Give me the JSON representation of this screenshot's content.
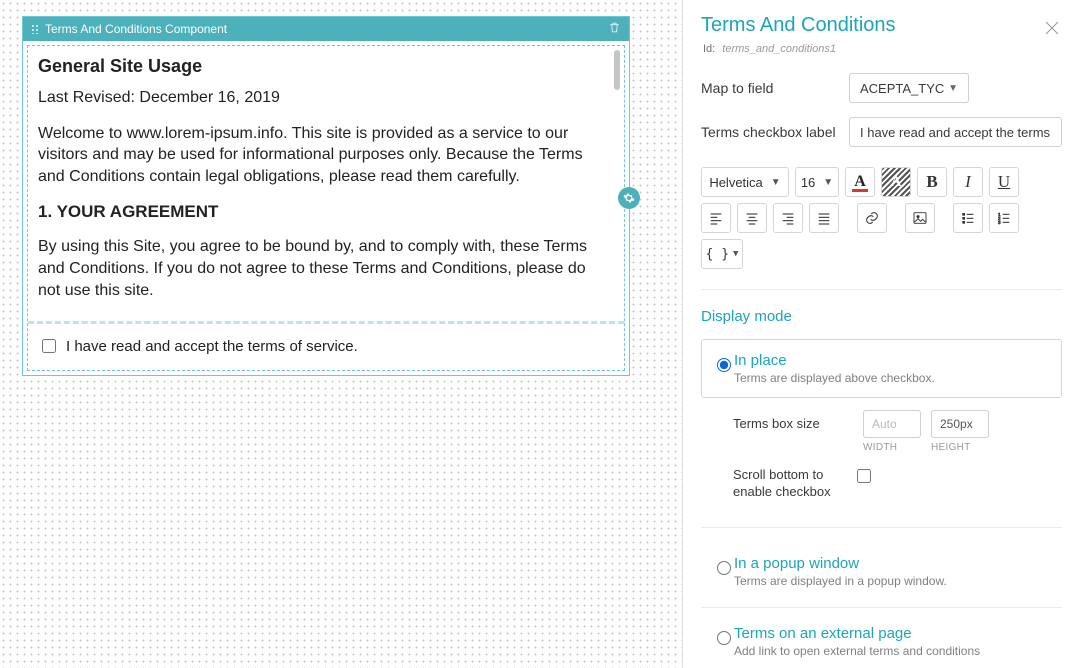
{
  "component": {
    "header_title": "Terms And Conditions Component",
    "terms": {
      "heading": "General Site Usage",
      "revised": "Last Revised: December 16, 2019",
      "intro": "Welcome to www.lorem-ipsum.info. This site is provided as a service to our visitors and may be used for informational purposes only. Because the Terms and Conditions contain legal obligations, please read them carefully.",
      "section1_title": "1. YOUR AGREEMENT",
      "section1_body": "By using this Site, you agree to be bound by, and to comply with, these Terms and Conditions. If you do not agree to these Terms and Conditions, please do not use this site."
    },
    "checkbox_label": "I have read and accept the terms of service."
  },
  "panel": {
    "title": "Terms And Conditions",
    "id_label": "Id:",
    "id_value": "terms_and_conditions1",
    "map_to_field_label": "Map to field",
    "map_to_field_value": "ACEPTA_TYC",
    "checkbox_label_label": "Terms checkbox label",
    "checkbox_label_value": "I have read and accept the terms of service",
    "toolbar": {
      "font_family": "Helvetica",
      "font_size": "16",
      "bold": "B",
      "italic": "I",
      "underline": "U",
      "code": "{ }"
    },
    "display_mode_label": "Display mode",
    "modes": {
      "in_place": {
        "title": "In place",
        "desc": "Terms are displayed above checkbox."
      },
      "popup": {
        "title": "In a popup window",
        "desc": "Terms are displayed in a popup window."
      },
      "external": {
        "title": "Terms on an external page",
        "desc": "Add link to open external terms and conditions"
      }
    },
    "terms_box_size_label": "Terms box size",
    "width_placeholder": "Auto",
    "width_caption": "WIDTH",
    "height_value": "250px",
    "height_caption": "HEIGHT",
    "scroll_bottom_label": "Scroll bottom to enable checkbox"
  }
}
